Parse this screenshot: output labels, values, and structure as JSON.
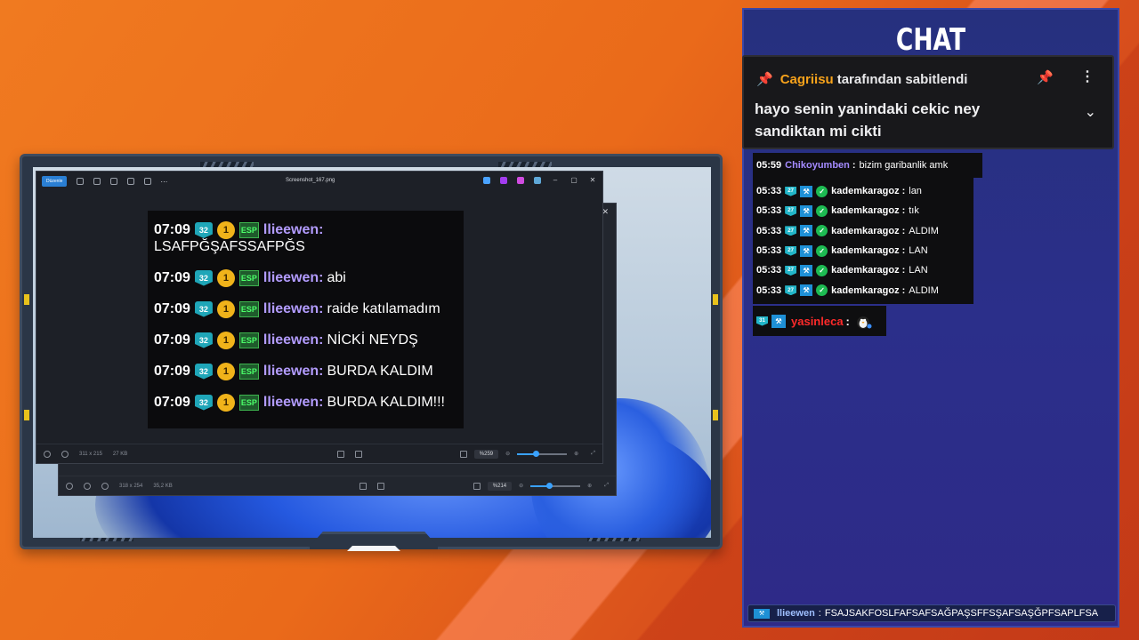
{
  "chat_panel": {
    "title": "CHAT",
    "pinned": {
      "pinned_by_user": "Cagriisu",
      "pinned_by_text": "tarafından sabitlendi",
      "message": "hayo senin yanindaki cekic ney sandiktan mi cikti"
    },
    "messages": [
      {
        "time": "05:59",
        "user": "Chikoyumben",
        "user_color": "#a48bff",
        "text": "bizim garibanlik amk"
      },
      {
        "time": "05:33",
        "badge": "27",
        "user": "kademkaragoz",
        "user_color": "#ffffff",
        "text": "lan"
      },
      {
        "time": "05:33",
        "badge": "27",
        "user": "kademkaragoz",
        "user_color": "#ffffff",
        "text": "tık"
      },
      {
        "time": "05:33",
        "badge": "27",
        "user": "kademkaragoz",
        "user_color": "#ffffff",
        "text": "ALDIM"
      },
      {
        "time": "05:33",
        "badge": "27",
        "user": "kademkaragoz",
        "user_color": "#ffffff",
        "text": "LAN"
      },
      {
        "time": "05:33",
        "badge": "27",
        "user": "kademkaragoz",
        "user_color": "#ffffff",
        "text": "LAN"
      },
      {
        "time": "05:33",
        "badge": "27",
        "user": "kademkaragoz",
        "user_color": "#ffffff",
        "text": "ALDIM"
      },
      {
        "badge": "31",
        "user": "yasinleca",
        "user_color": "#ff2a2a",
        "text": ""
      }
    ],
    "bottom_message": {
      "user": "llieewen",
      "text": "FSAJSAKFOSLFAFSAFSAĞPAŞSFFSŞAFSAŞĞPFSAPLFSA"
    }
  },
  "viewer": {
    "edit_button": "Düzenle",
    "front_title": "Screenshot_167.png",
    "front_dims": "311 x 215",
    "front_size": "27 KB",
    "front_zoom": "%259",
    "back_dims": "318 x 254",
    "back_size": "35,2 KB",
    "back_zoom": "%214"
  },
  "screenshot_chat": {
    "rows": [
      {
        "time": "07:09",
        "badge_num": "32",
        "coin": "1",
        "tag": "ESP",
        "user": "llieewen",
        "text": "LSAFPĞŞAFSSAFPĞS"
      },
      {
        "time": "07:09",
        "badge_num": "32",
        "coin": "1",
        "tag": "ESP",
        "user": "llieewen",
        "text": "abi"
      },
      {
        "time": "07:09",
        "badge_num": "32",
        "coin": "1",
        "tag": "ESP",
        "user": "llieewen",
        "text": "raide katılamadım"
      },
      {
        "time": "07:09",
        "badge_num": "32",
        "coin": "1",
        "tag": "ESP",
        "user": "llieewen",
        "text": "NİCKİ NEYDŞ"
      },
      {
        "time": "07:09",
        "badge_num": "32",
        "coin": "1",
        "tag": "ESP",
        "user": "llieewen",
        "text": "BURDA KALDIM"
      },
      {
        "time": "07:09",
        "badge_num": "32",
        "coin": "1",
        "tag": "ESP",
        "user": "llieewen",
        "text": "BURDA KALDIM!!!"
      }
    ]
  },
  "colors": {
    "background_orange": "#ea6a1a",
    "chat_panel_blue": "#2b2f8a",
    "pin_by_user": "#f7a21b",
    "screenshot_username": "#b39cff"
  }
}
